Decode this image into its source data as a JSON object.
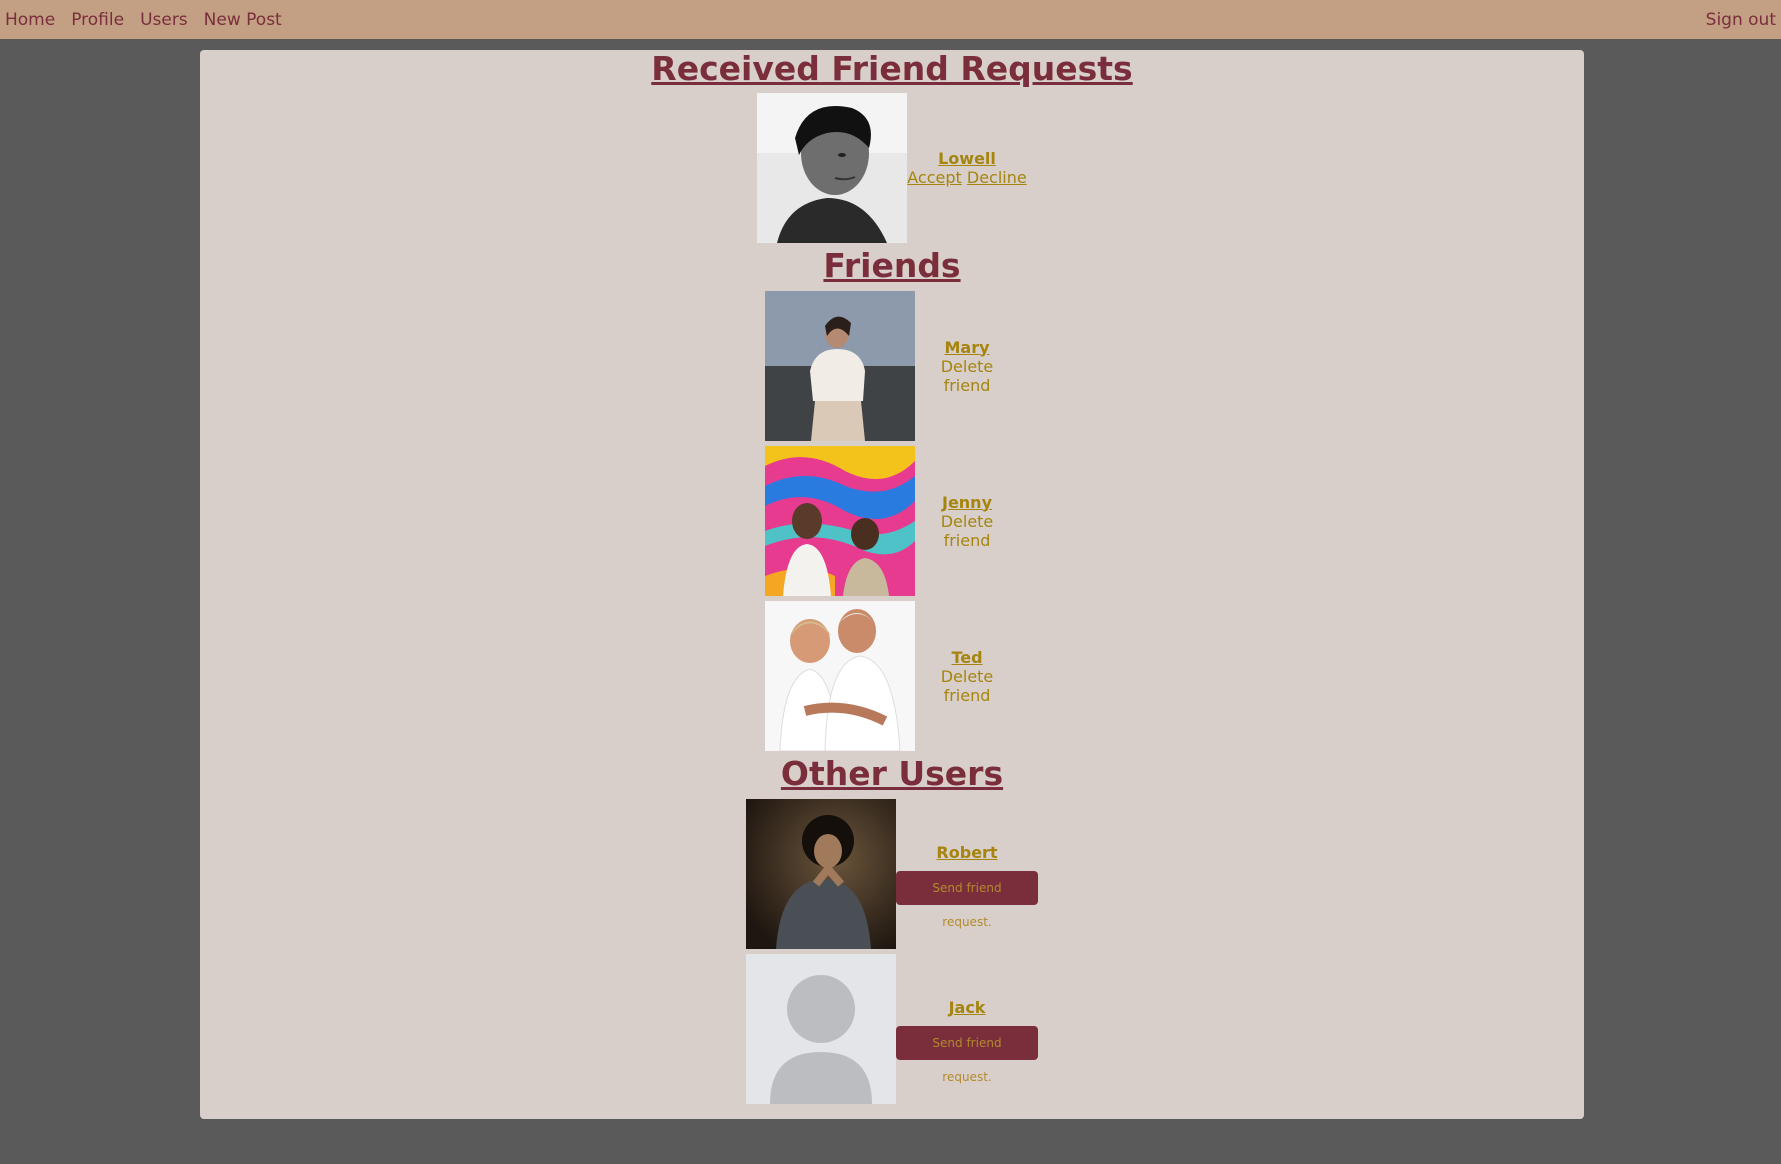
{
  "nav": {
    "home": "Home",
    "profile": "Profile",
    "users": "Users",
    "new_post": "New Post",
    "sign_out": "Sign out"
  },
  "received": {
    "title": "Received Friend Requests",
    "requests": [
      {
        "name": "Lowell",
        "accept": "Accept",
        "decline": "Decline"
      }
    ]
  },
  "friends": {
    "title": "Friends",
    "items": [
      {
        "name": "Mary",
        "action": "Delete friend"
      },
      {
        "name": "Jenny",
        "action": "Delete friend"
      },
      {
        "name": "Ted",
        "action": "Delete friend"
      }
    ]
  },
  "others": {
    "title": "Other Users",
    "items": [
      {
        "name": "Robert",
        "action": "Send friend request."
      },
      {
        "name": "Jack",
        "action": "Send friend request."
      }
    ]
  }
}
